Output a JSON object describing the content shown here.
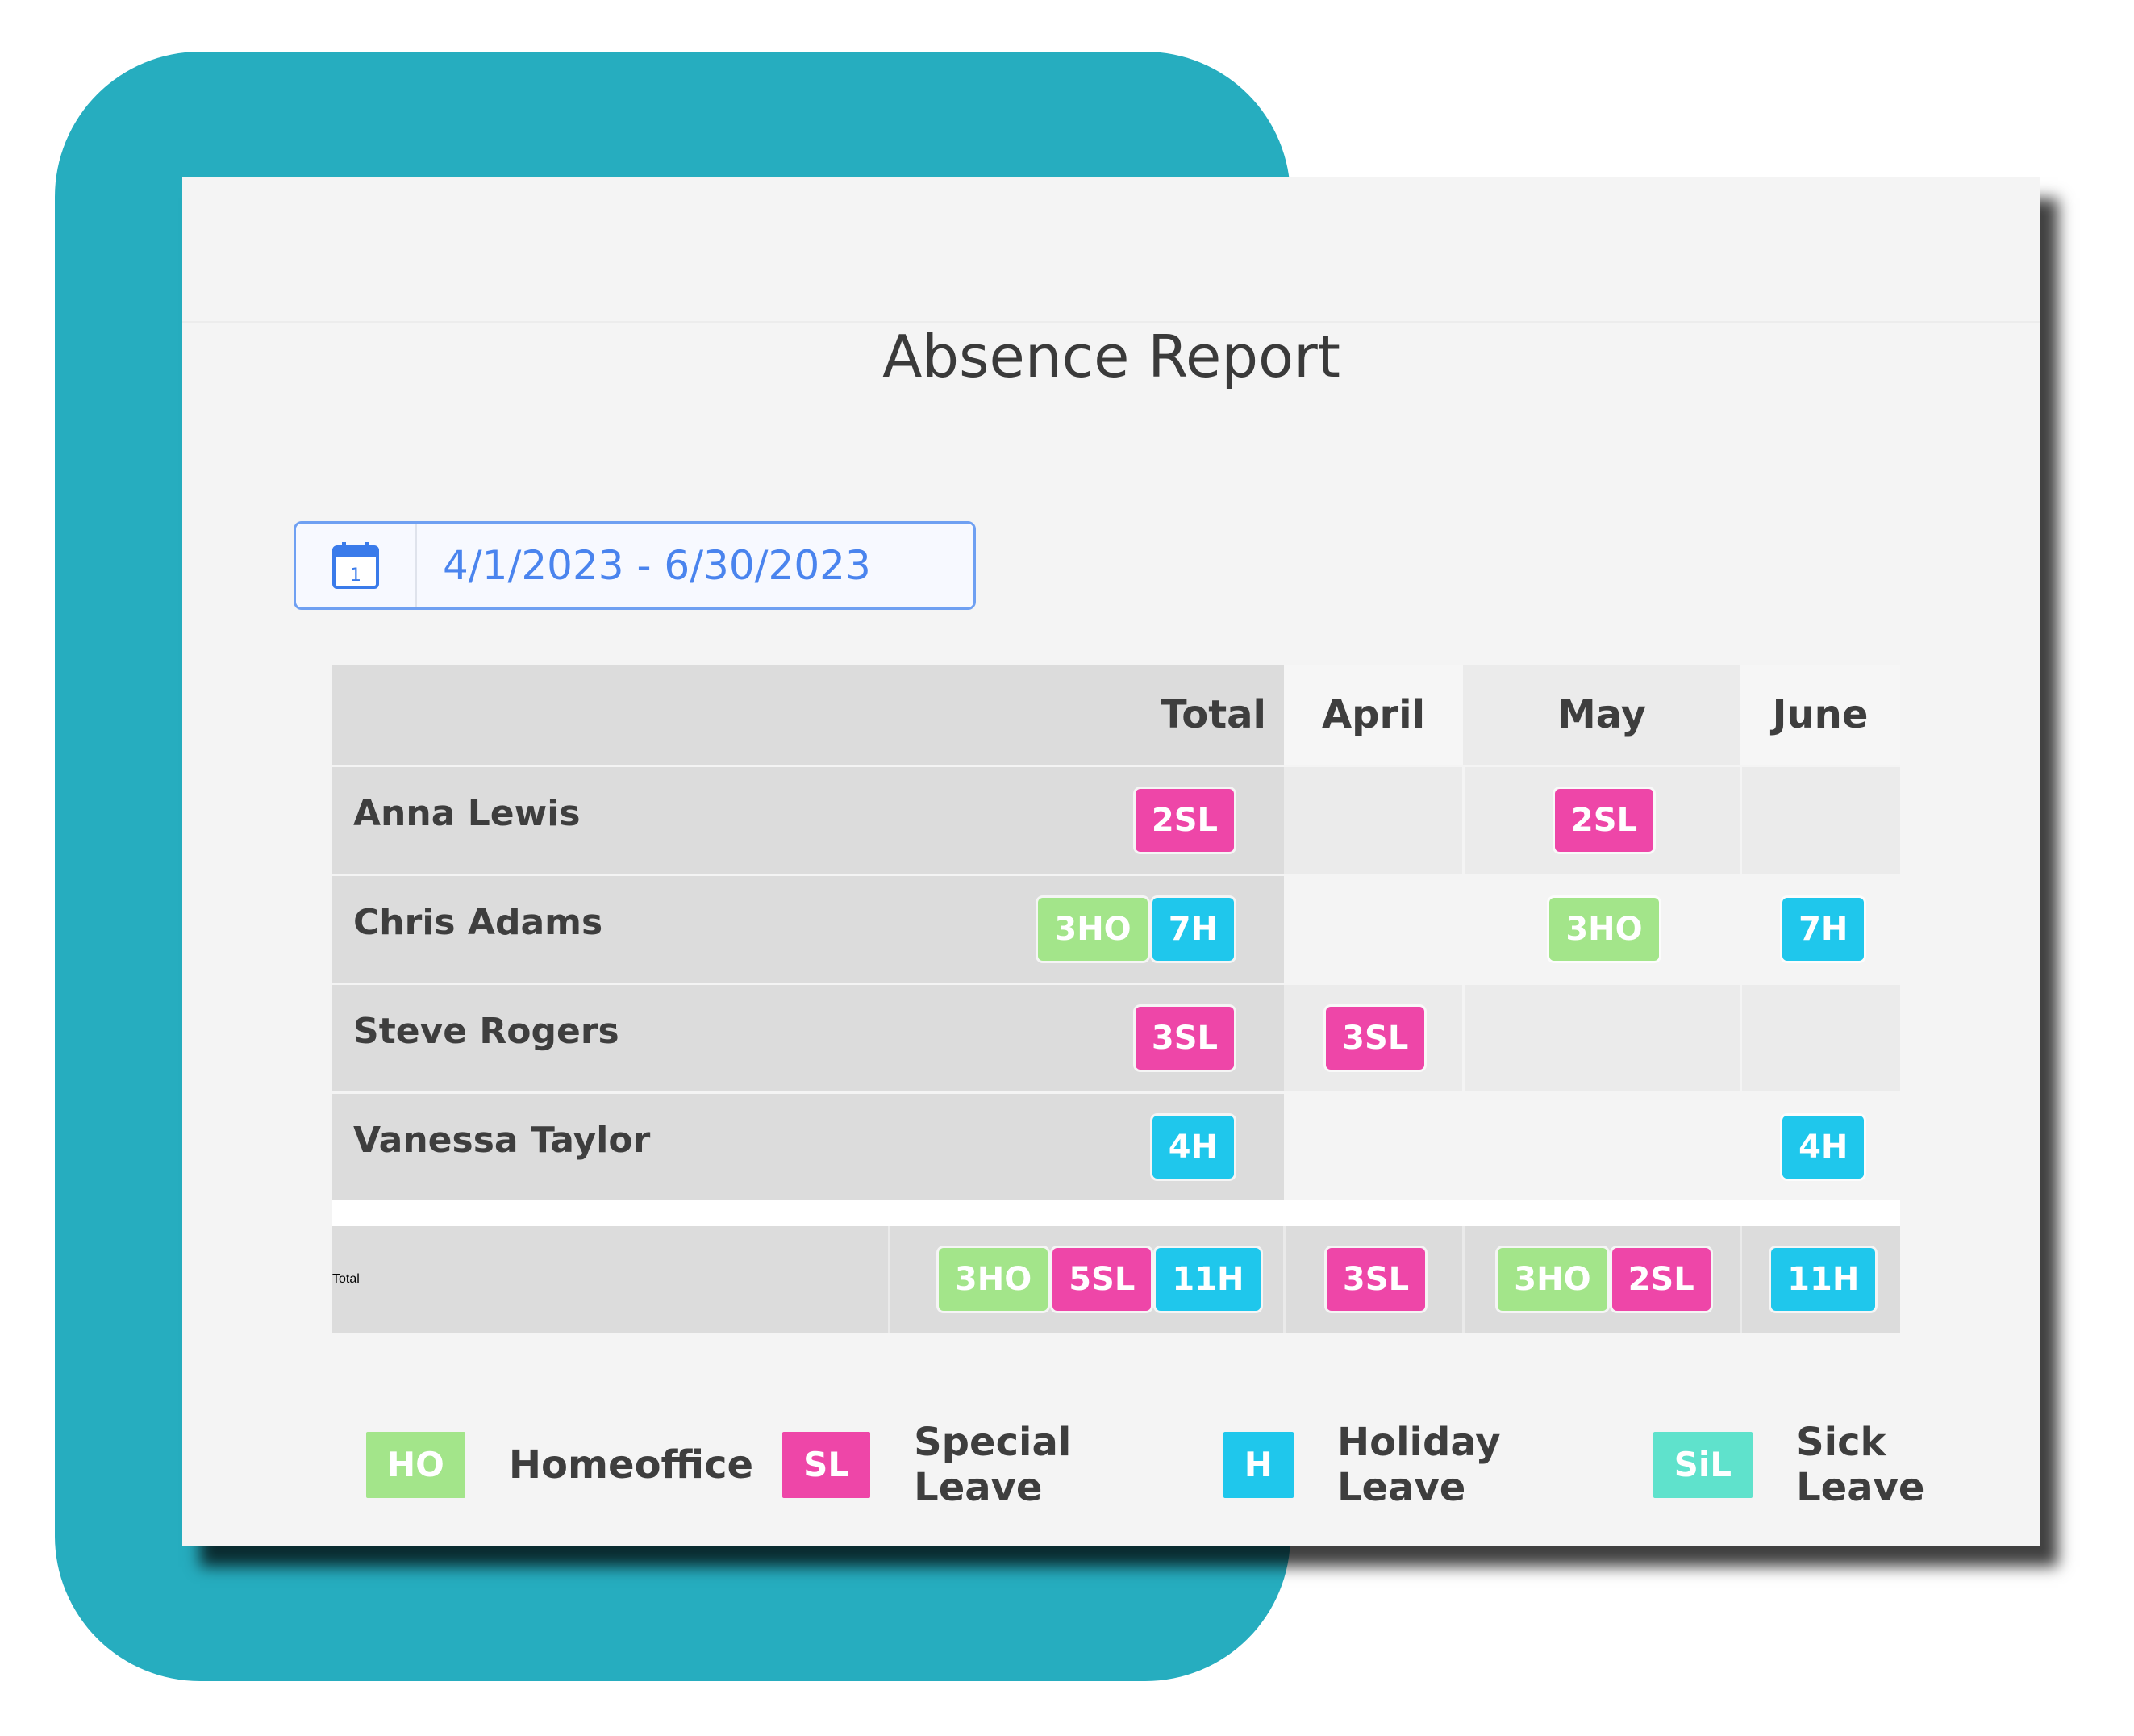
{
  "report": {
    "title": "Absence Report"
  },
  "date_range": {
    "value": "4/1/2023 - 6/30/2023",
    "icon": "calendar-icon",
    "icon_day": "1"
  },
  "table": {
    "headers": {
      "name": "",
      "total": "Total",
      "april": "April",
      "may": "May",
      "june": "June"
    },
    "rows": [
      {
        "name": "Anna Lewis",
        "total": [
          {
            "label": "2SL",
            "type": "SL"
          }
        ],
        "april": [],
        "may": [
          {
            "label": "2SL",
            "type": "SL"
          }
        ],
        "june": []
      },
      {
        "name": "Chris Adams",
        "total": [
          {
            "label": "3HO",
            "type": "HO"
          },
          {
            "label": "7H",
            "type": "H"
          }
        ],
        "april": [],
        "may": [
          {
            "label": "3HO",
            "type": "HO"
          }
        ],
        "june": [
          {
            "label": "7H",
            "type": "H"
          }
        ]
      },
      {
        "name": "Steve Rogers",
        "total": [
          {
            "label": "3SL",
            "type": "SL"
          }
        ],
        "april": [
          {
            "label": "3SL",
            "type": "SL"
          }
        ],
        "may": [],
        "june": []
      },
      {
        "name": "Vanessa Taylor",
        "total": [
          {
            "label": "4H",
            "type": "H"
          }
        ],
        "april": [],
        "may": [],
        "june": [
          {
            "label": "4H",
            "type": "H"
          }
        ]
      }
    ],
    "totals": {
      "name": "Total",
      "total": [
        {
          "label": "3HO",
          "type": "HO"
        },
        {
          "label": "5SL",
          "type": "SL"
        },
        {
          "label": "11H",
          "type": "H"
        }
      ],
      "april": [
        {
          "label": "3SL",
          "type": "SL"
        }
      ],
      "may": [
        {
          "label": "3HO",
          "type": "HO"
        },
        {
          "label": "2SL",
          "type": "SL"
        }
      ],
      "june": [
        {
          "label": "11H",
          "type": "H"
        }
      ]
    }
  },
  "legend": [
    {
      "code": "HO",
      "label": "Homeoffice",
      "color": "#a3e58a"
    },
    {
      "code": "SL",
      "label": "Special Leave",
      "color": "#ee46a8"
    },
    {
      "code": "H",
      "label": "Holiday Leave",
      "color": "#1fc7ec"
    },
    {
      "code": "SiL",
      "label": "Sick Leave",
      "color": "#5fe2cc"
    }
  ],
  "colors": {
    "teal_background": "#26adbf",
    "HO": "#a3e58a",
    "SL": "#ee46a8",
    "H": "#1fc7ec",
    "SiL": "#5fe2cc",
    "date_text": "#4a84ee"
  }
}
